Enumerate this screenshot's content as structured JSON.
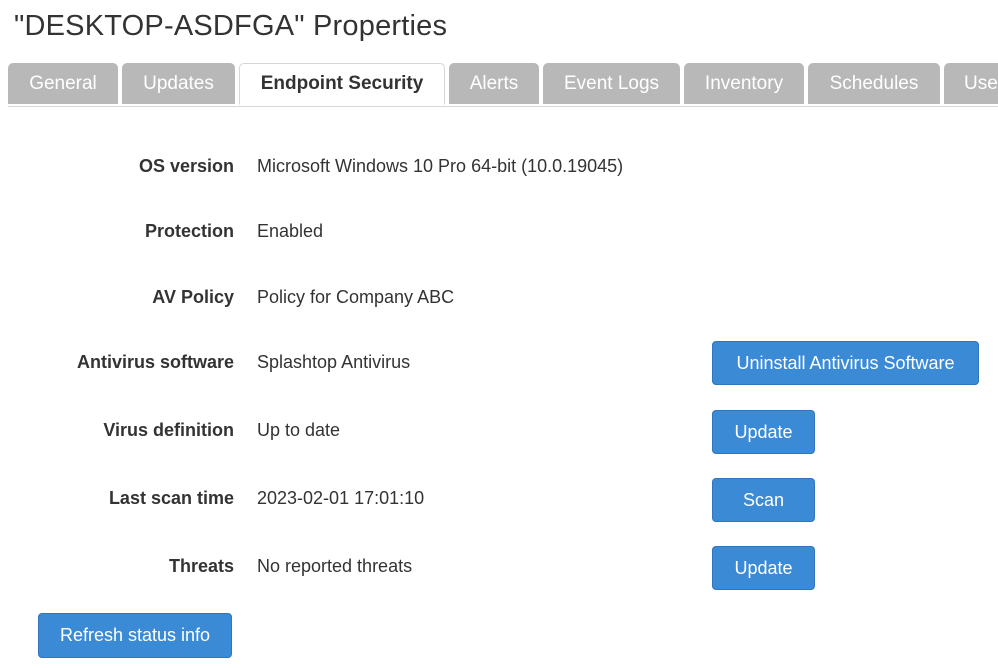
{
  "window": {
    "title": "\"DESKTOP-ASDFGA\" Properties"
  },
  "tabs": [
    {
      "label": "General",
      "active": false
    },
    {
      "label": "Updates",
      "active": false
    },
    {
      "label": "Endpoint Security",
      "active": true
    },
    {
      "label": "Alerts",
      "active": false
    },
    {
      "label": "Event Logs",
      "active": false
    },
    {
      "label": "Inventory",
      "active": false
    },
    {
      "label": "Schedules",
      "active": false
    },
    {
      "label": "Use",
      "active": false
    }
  ],
  "fields": {
    "os_version": {
      "label": "OS version",
      "value": "Microsoft Windows 10 Pro 64-bit (10.0.19045)"
    },
    "protection": {
      "label": "Protection",
      "value": "Enabled"
    },
    "av_policy": {
      "label": "AV Policy",
      "value": "Policy for Company ABC"
    },
    "antivirus_software": {
      "label": "Antivirus software",
      "value": "Splashtop Antivirus",
      "button": "Uninstall Antivirus Software"
    },
    "virus_definition": {
      "label": "Virus definition",
      "value": "Up to date",
      "button": "Update"
    },
    "last_scan_time": {
      "label": "Last scan time",
      "value": "2023-02-01 17:01:10",
      "button": "Scan"
    },
    "threats": {
      "label": "Threats",
      "value": "No reported threats",
      "button": "Update"
    }
  },
  "actions": {
    "refresh_label": "Refresh status info"
  },
  "colors": {
    "primary_button": "#3a8ad6",
    "inactive_tab": "#b8b8b8",
    "text": "#333333"
  }
}
